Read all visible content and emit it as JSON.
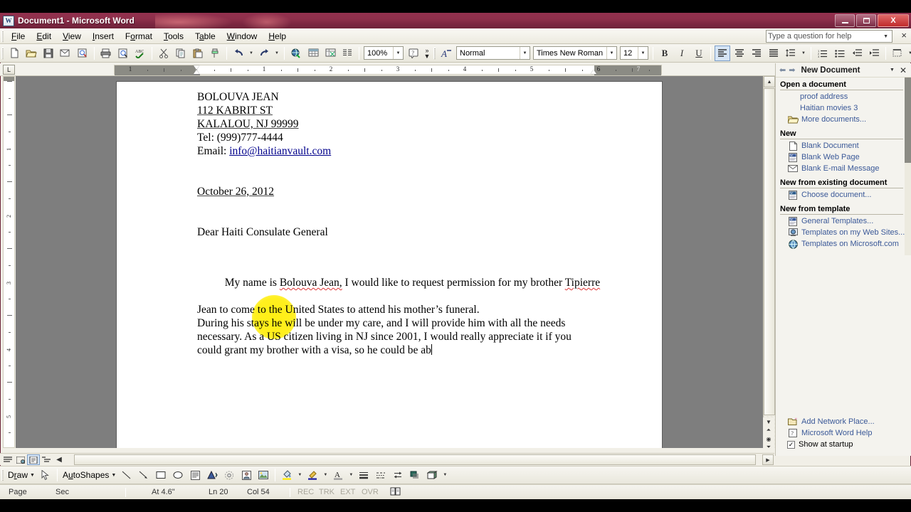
{
  "window": {
    "title": "Document1 - Microsoft Word",
    "app_icon": "word-document-icon",
    "minimize_label": "Minimize",
    "restore_label": "Restore",
    "close_label": "Close"
  },
  "menubar": {
    "items": [
      {
        "label": "File",
        "mnemonic": "F"
      },
      {
        "label": "Edit",
        "mnemonic": "E"
      },
      {
        "label": "View",
        "mnemonic": "V"
      },
      {
        "label": "Insert",
        "mnemonic": "I"
      },
      {
        "label": "Format",
        "mnemonic": "o"
      },
      {
        "label": "Tools",
        "mnemonic": "T"
      },
      {
        "label": "Table",
        "mnemonic": "a"
      },
      {
        "label": "Window",
        "mnemonic": "W"
      },
      {
        "label": "Help",
        "mnemonic": "H"
      }
    ],
    "help_placeholder": "Type a question for help",
    "close_label": "×"
  },
  "standard_toolbar": {
    "buttons": [
      "new-document-icon",
      "open-icon",
      "save-icon",
      "email-icon",
      "search-icon",
      "print-icon",
      "print-preview-icon",
      "spelling-grammar-icon",
      "cut-icon",
      "copy-icon",
      "paste-icon",
      "format-painter-icon",
      "undo-icon",
      "redo-icon",
      "insert-hyperlink-icon",
      "insert-table-icon",
      "insert-excel-table-icon",
      "columns-icon",
      "drawing-icon"
    ],
    "zoom_value": "100%",
    "help_icon": "word-help-icon",
    "overflow_label": "Toolbar Options"
  },
  "formatting_toolbar": {
    "style_icon": "styles-and-formatting-icon",
    "style_value": "Normal",
    "font_value": "Times New Roman",
    "size_value": "12",
    "bold_label": "B",
    "italic_label": "I",
    "underline_label": "U",
    "align_left_label": "align-left",
    "align_center_label": "align-center",
    "align_right_label": "align-right",
    "align_justify_label": "align-justify",
    "line_spacing_label": "line-spacing",
    "numbering_label": "numbering",
    "bullets_label": "bullets",
    "decrease_indent_label": "decrease-indent",
    "increase_indent_label": "increase-indent",
    "borders_label": "outside-border",
    "highlight_label": "highlight",
    "font_color_label": "font-color",
    "active_alignment": "align-left"
  },
  "ruler": {
    "horizontal_labels": [
      "1",
      "2",
      "3",
      "4",
      "5",
      "7"
    ],
    "vertical_labels": [
      "1",
      "2",
      "3",
      "4",
      "5"
    ],
    "tab_selector": "L"
  },
  "document": {
    "sender_name": "BOLOUVA JEAN",
    "sender_street": "112 KABRIT ST",
    "sender_city": "KALALOU, NJ 99999",
    "sender_tel": "Tel: (999)777-4444",
    "email_label": "Email: ",
    "email_address": "info@haitianvault.com",
    "date": "October 26, 2012",
    "salutation": "Dear Haiti Consulate General",
    "body_lines": [
      {
        "pre": "My name is ",
        "mis": "Bolouva Jean,",
        "mid": " I would like to request permission for my brother ",
        "mis2": "Tipierre"
      },
      {
        "text": "Jean to come to the United States to attend his mother’s funeral."
      },
      {
        "text": "During his stays he will be under my care, and I will provide him with all the needs"
      },
      {
        "text": "necessary. As a US citizen living in NJ since 2001, I would really appreciate it if you"
      },
      {
        "text": "could grant my brother with a visa, so he could be ab"
      }
    ],
    "highlight_color": "#ffed00"
  },
  "task_pane": {
    "title": "New Document",
    "back_icon": "back-arrow-icon",
    "forward_icon": "forward-arrow-icon",
    "dropdown_icon": "chevron-down-icon",
    "close_icon": "close-icon",
    "sections": [
      {
        "heading": "Open a document",
        "items": [
          {
            "label": "proof address",
            "icon": null
          },
          {
            "label": "Haitian movies 3",
            "icon": null
          },
          {
            "label": "More documents...",
            "icon": "open-folder-icon"
          }
        ]
      },
      {
        "heading": "New",
        "items": [
          {
            "label": "Blank Document",
            "icon": "blank-page-icon"
          },
          {
            "label": "Blank Web Page",
            "icon": "web-page-icon"
          },
          {
            "label": "Blank E-mail Message",
            "icon": "envelope-icon"
          }
        ]
      },
      {
        "heading": "New from existing document",
        "items": [
          {
            "label": "Choose document...",
            "icon": "choose-document-icon"
          }
        ]
      },
      {
        "heading": "New from template",
        "items": [
          {
            "label": "General Templates...",
            "icon": "template-icon"
          },
          {
            "label": "Templates on my Web Sites...",
            "icon": "web-template-icon"
          },
          {
            "label": "Templates on Microsoft.com",
            "icon": "globe-icon"
          }
        ]
      }
    ],
    "footer": [
      {
        "label": "Add Network Place...",
        "icon": "network-place-icon"
      },
      {
        "label": "Microsoft Word Help",
        "icon": "help-question-icon"
      }
    ],
    "show_at_startup_label": "Show at startup",
    "show_at_startup_checked": true
  },
  "drawing_toolbar": {
    "draw_label": "Draw",
    "draw_mnemonic": "r",
    "select_icon": "select-objects-icon",
    "autoshapes_label": "AutoShapes",
    "autoshapes_mnemonic": "u",
    "tools": [
      "line-icon",
      "arrow-icon",
      "rectangle-icon",
      "oval-icon",
      "text-box-icon",
      "wordart-icon",
      "diagram-icon",
      "clip-art-icon",
      "picture-icon",
      "fill-color-icon",
      "line-color-icon",
      "font-color-icon",
      "line-style-icon",
      "dash-style-icon",
      "arrow-style-icon",
      "shadow-style-icon",
      "3d-style-icon"
    ]
  },
  "status_bar": {
    "page_label": "Page",
    "sec_label": "Sec",
    "at_label": "At 4.6\"",
    "line_label": "Ln 20",
    "col_label": "Col 54",
    "rec_label": "REC",
    "trk_label": "TRK",
    "ext_label": "EXT",
    "ovr_label": "OVR",
    "language_icon": "spelling-status-icon"
  },
  "view_bar": {
    "buttons": [
      "normal-view-icon",
      "web-layout-view-icon",
      "print-layout-view-icon",
      "outline-view-icon",
      "reading-view-icon"
    ],
    "active": "print-layout-view-icon"
  },
  "scrollbar": {
    "up_icon": "scroll-up-icon",
    "down_icon": "scroll-down-icon",
    "prev_page_icon": "previous-page-icon",
    "select_browse_object_icon": "select-browse-object-icon",
    "next_page_icon": "next-page-icon",
    "left_icon": "scroll-left-icon",
    "right_icon": "scroll-right-icon"
  }
}
